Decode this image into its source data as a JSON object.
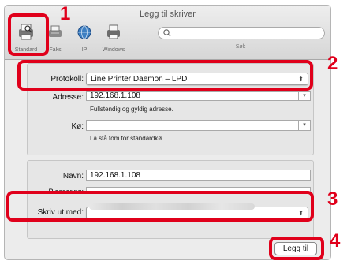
{
  "window": {
    "title": "Legg til skriver"
  },
  "toolbar": {
    "standard_label": "Standard",
    "faks_label": "Faks",
    "ip_label": "IP",
    "windows_label": "Windows",
    "search_label": "Søk",
    "search_placeholder": ""
  },
  "form": {
    "protokoll_label": "Protokoll:",
    "protokoll_value": "Line Printer Daemon – LPD",
    "adresse_label": "Adresse:",
    "adresse_value": "192.168.1.108",
    "adresse_hint": "Fullstendig og gyldig adresse.",
    "ko_label": "Kø:",
    "ko_value": "",
    "ko_hint": "La stå tom for standardkø.",
    "navn_label": "Navn:",
    "navn_value": "192.168.1.108",
    "plassering_label": "Plassering:",
    "plassering_value": "",
    "skriv_label": "Skriv ut med:",
    "skriv_value": ""
  },
  "buttons": {
    "add_label": "Legg til"
  },
  "callouts": [
    "1",
    "2",
    "3",
    "4"
  ],
  "colors": {
    "callout": "#e0001b"
  }
}
